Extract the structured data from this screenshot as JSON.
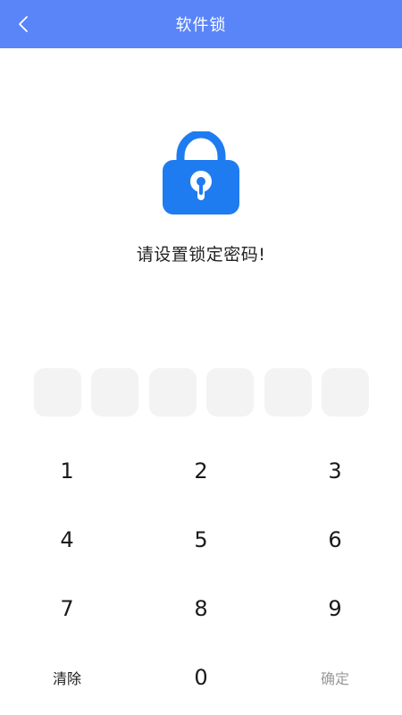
{
  "header": {
    "title": "软件锁",
    "back_icon": "chevron-left-icon",
    "background_color": "#5a85f8"
  },
  "lock": {
    "icon": "lock-icon",
    "color": "#1e7cf0"
  },
  "prompt": "请设置锁定密码!",
  "pin": {
    "length": 6,
    "entered": 0
  },
  "keypad": {
    "rows": [
      [
        "1",
        "2",
        "3"
      ],
      [
        "4",
        "5",
        "6"
      ],
      [
        "7",
        "8",
        "9"
      ]
    ],
    "clear_label": "清除",
    "zero_label": "0",
    "confirm_label": "确定"
  }
}
